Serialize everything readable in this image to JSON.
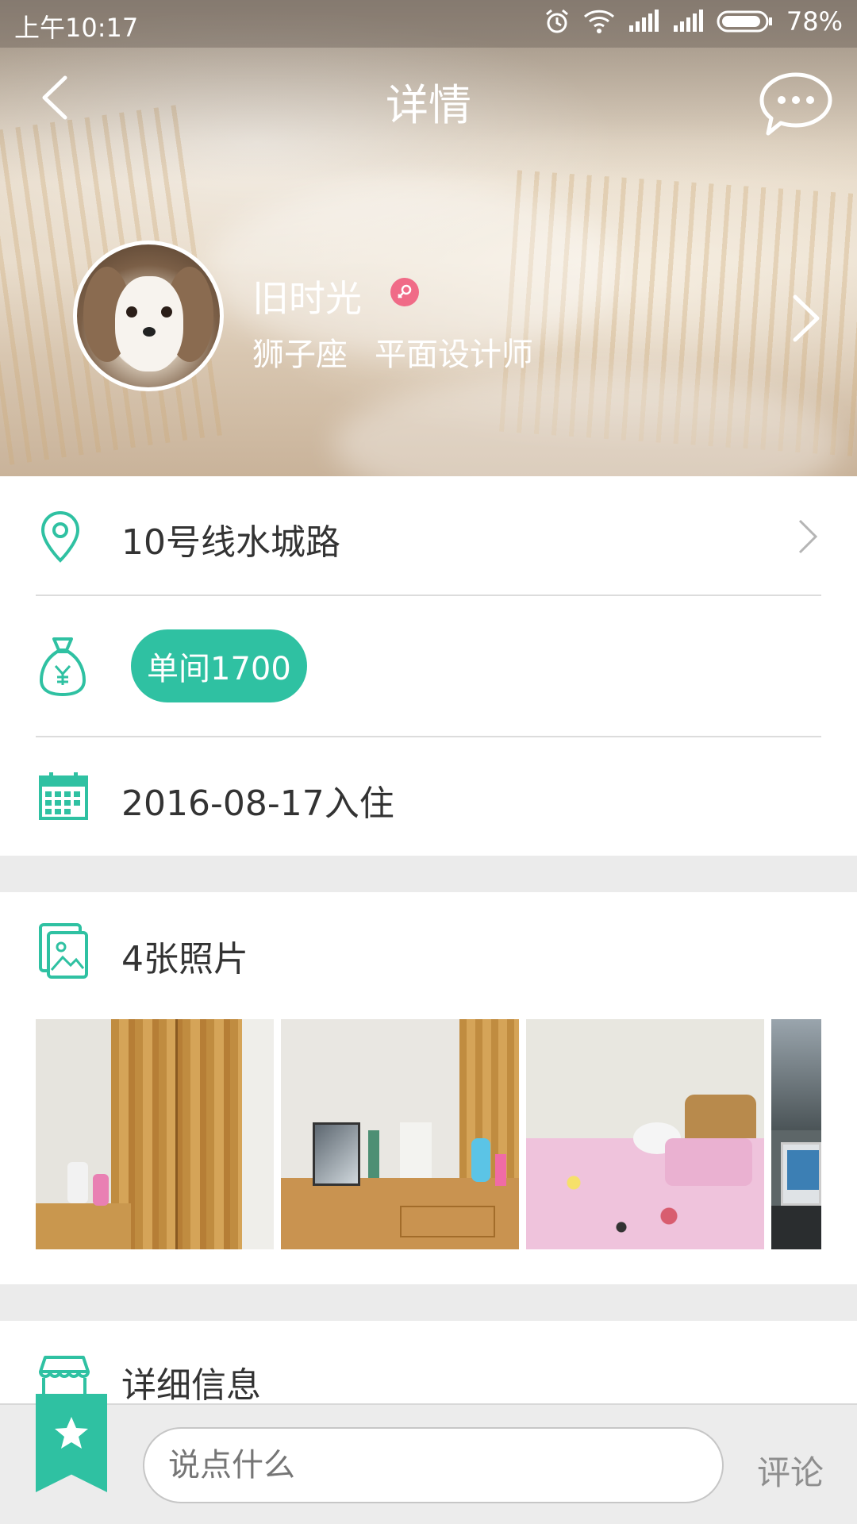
{
  "status_bar": {
    "time": "上午10:17",
    "battery": "78%",
    "icons": [
      "alarm-icon",
      "wifi-icon",
      "signal-icon",
      "signal-icon",
      "battery-icon"
    ]
  },
  "navbar": {
    "title": "详情",
    "back_icon": "back-arrow-icon",
    "chat_icon": "chat-bubble-icon"
  },
  "profile": {
    "name": "旧时光",
    "gender": "female",
    "zodiac": "狮子座",
    "occupation": "平面设计师"
  },
  "info": {
    "location": "10号线水城路",
    "price": "单间1700",
    "move_in": "2016-08-17入住"
  },
  "photos": {
    "title": "4张照片",
    "items": [
      "wardrobe",
      "desk",
      "bed",
      "window"
    ]
  },
  "details": {
    "title": "详细信息"
  },
  "bottom_bar": {
    "input_placeholder": "说点什么",
    "send_label": "评论"
  },
  "colors": {
    "accent": "#2fc1a2",
    "female": "#f06b87"
  }
}
